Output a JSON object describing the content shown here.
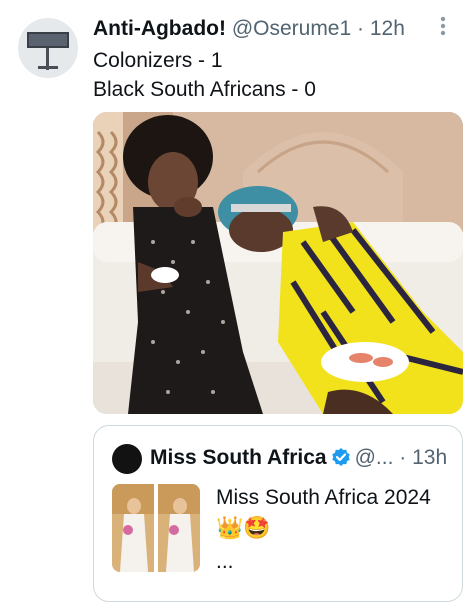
{
  "tweet": {
    "display_name": "Anti-Agbado!",
    "handle": "@Oserume1",
    "separator": "·",
    "time": "12h",
    "lines": [
      "Colonizers - 1",
      "Black South Africans - 0"
    ],
    "more_icon": "more-vertical-icon"
  },
  "quote": {
    "display_name": "Miss South Africa",
    "handle": "@...",
    "separator": "·",
    "time": "13h",
    "text": "Miss South Africa 2024",
    "emojis": [
      "👑",
      "🤩"
    ],
    "ellipsis": "...",
    "verified_icon": "verified-badge-icon"
  },
  "colors": {
    "text": "#0f1419",
    "secondary": "#536471",
    "border": "#cfd9de",
    "verified": "#1d9bf0",
    "yellow_dress": "#f2e21b"
  }
}
